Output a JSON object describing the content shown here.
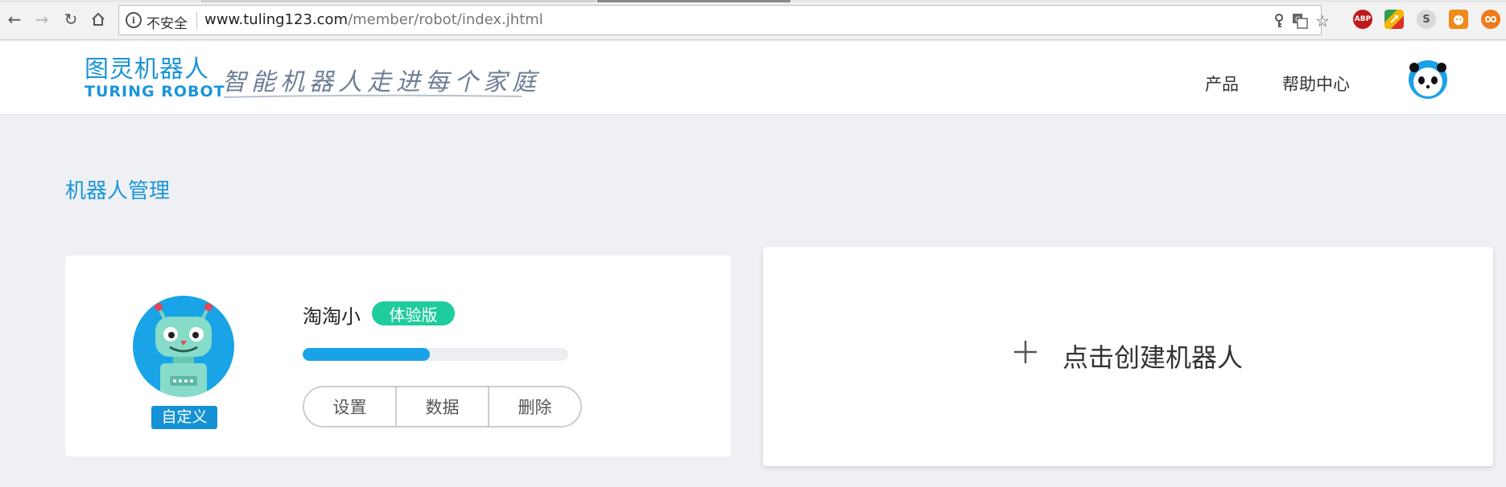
{
  "browser": {
    "security_label": "不安全",
    "url_host": "www.tuling123.com",
    "url_path": "/member/robot/index.jhtml",
    "extensions": [
      "ABP",
      "S"
    ]
  },
  "header": {
    "logo_cn": "图灵机器人",
    "logo_en": "TURING ROBOT",
    "slogan": "智能机器人走进每个家庭",
    "nav": [
      "产品",
      "帮助中心"
    ]
  },
  "main": {
    "section_title": "机器人管理",
    "robot": {
      "name": "淘淘小",
      "badge": "体验版",
      "tag": "自定义",
      "progress": 0.48,
      "actions": [
        "设置",
        "数据",
        "删除"
      ]
    },
    "create_label": "点击创建机器人"
  },
  "colors": {
    "brand": "#1a95d9",
    "badge": "#1fcd9c",
    "progress": "#1aa2e8"
  }
}
